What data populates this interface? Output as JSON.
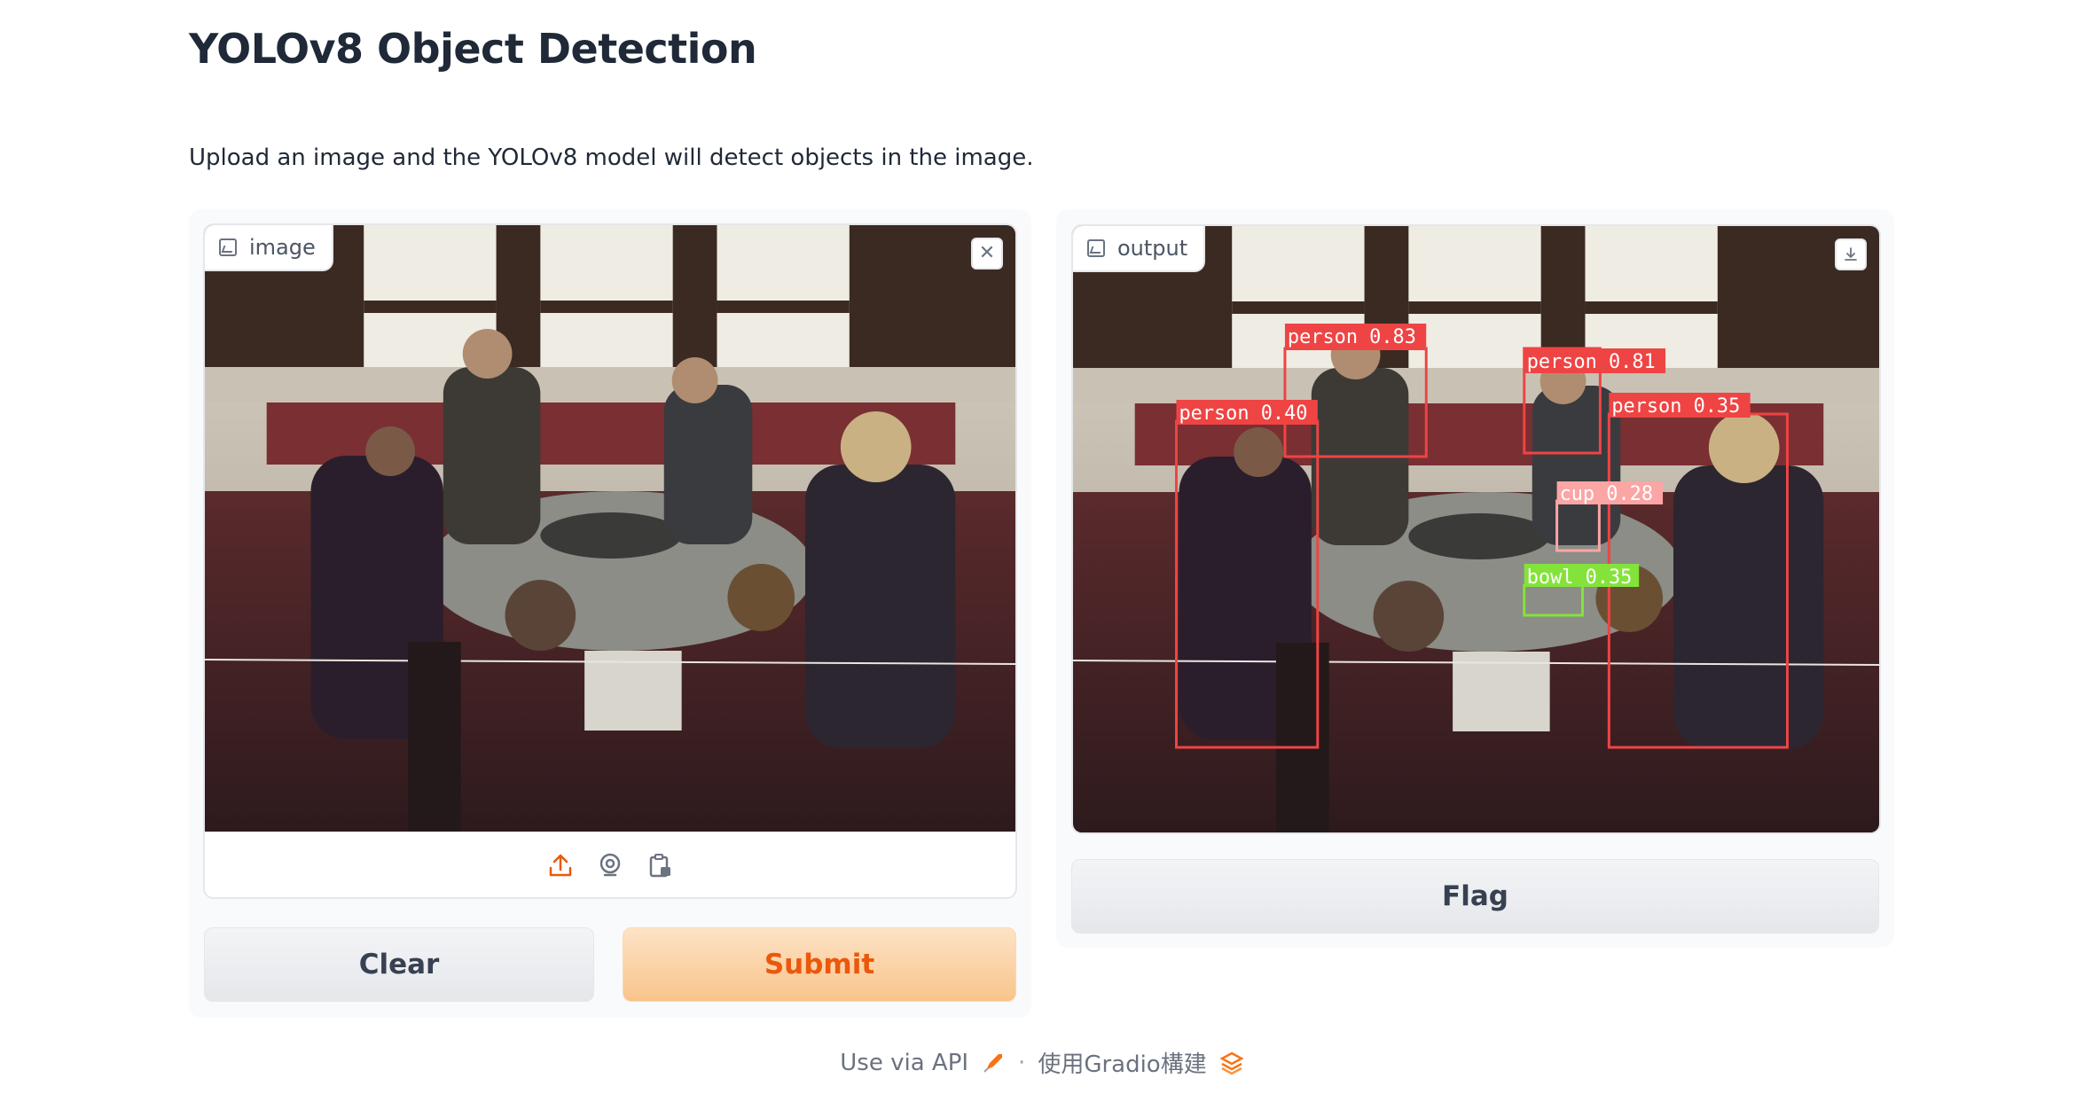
{
  "header": {
    "title": "YOLOv8 Object Detection",
    "description": "Upload an image and the YOLOv8 model will detect objects in the image."
  },
  "input_panel": {
    "label": "image",
    "icon": "image-icon",
    "clear_icon": "close-icon",
    "tools": [
      "upload-icon",
      "webcam-icon",
      "clipboard-icon"
    ],
    "clear_label": "Clear",
    "submit_label": "Submit"
  },
  "output_panel": {
    "label": "output",
    "icon": "image-icon",
    "download_icon": "download-icon",
    "flag_label": "Flag",
    "detections": [
      {
        "label": "person 0.83",
        "color": "#ef4444"
      },
      {
        "label": "person 0.81",
        "color": "#ef4444"
      },
      {
        "label": "person 0.40",
        "color": "#ef4444"
      },
      {
        "label": "person 0.35",
        "color": "#ef4444"
      },
      {
        "label": "cup 0.28",
        "color": "#fca5a5"
      },
      {
        "label": "bowl 0.35",
        "color": "#84e33a"
      }
    ]
  },
  "footer": {
    "api_label": "Use via API",
    "separator": "·",
    "built_with": "使用Gradio構建"
  },
  "colors": {
    "accent": "#ea580c",
    "submit_bg": "#f9c48b",
    "panel_bg": "#f9fafb"
  }
}
